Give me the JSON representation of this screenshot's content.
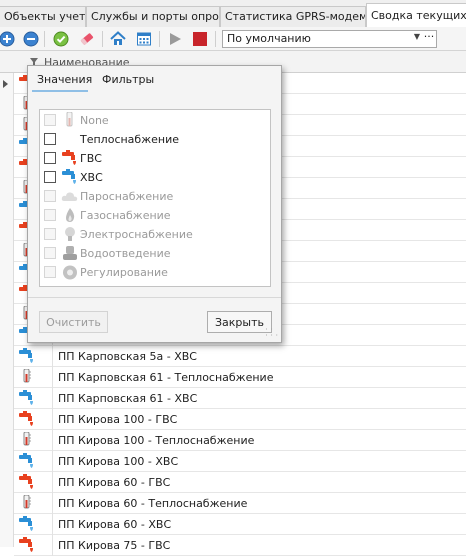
{
  "tabs": [
    {
      "label": "Объекты учета",
      "active": false
    },
    {
      "label": "Службы и порты опроса",
      "active": false
    },
    {
      "label": "Статистика GPRS-модемов",
      "active": false
    },
    {
      "label": "Сводка текущих",
      "active": true
    }
  ],
  "toolbar": {
    "icons": [
      "add-icon",
      "remove-icon",
      "apply-icon",
      "eraser-icon",
      "home-icon",
      "calendar-icon",
      "play-icon",
      "stop-icon"
    ],
    "combo_value": "По умолчанию",
    "combo_dots": "···"
  },
  "grid": {
    "column_header": "Наименование",
    "rows": [
      {
        "icon": "hot-tap-icon",
        "text": ""
      },
      {
        "icon": "thermometer-icon",
        "text": ""
      },
      {
        "icon": "thermometer-icon",
        "text": ""
      },
      {
        "icon": "cold-tap-icon",
        "text": ""
      },
      {
        "icon": "hot-tap-icon",
        "text": ""
      },
      {
        "icon": "thermometer-icon",
        "text": ""
      },
      {
        "icon": "cold-tap-icon",
        "text": ""
      },
      {
        "icon": "hot-tap-icon",
        "text": ""
      },
      {
        "icon": "thermometer-icon",
        "text": ""
      },
      {
        "icon": "cold-tap-icon",
        "text": ""
      },
      {
        "icon": "hot-tap-icon",
        "text": ""
      },
      {
        "icon": "thermometer-icon",
        "text": ""
      },
      {
        "icon": "cold-tap-icon",
        "text": ""
      },
      {
        "icon": "cold-tap-icon",
        "text": "ПП Карповская 5а - ХВС"
      },
      {
        "icon": "thermometer-icon",
        "text": "ПП Карповская 61 - Теплоснабжение"
      },
      {
        "icon": "cold-tap-icon",
        "text": "ПП Карповская 61 - ХВС"
      },
      {
        "icon": "hot-tap-icon",
        "text": "ПП Кирова 100 - ГВС"
      },
      {
        "icon": "thermometer-icon",
        "text": "ПП Кирова 100 - Теплоснабжение"
      },
      {
        "icon": "cold-tap-icon",
        "text": "ПП Кирова 100 - ХВС"
      },
      {
        "icon": "hot-tap-icon",
        "text": "ПП Кирова 60 - ГВС"
      },
      {
        "icon": "thermometer-icon",
        "text": "ПП Кирова 60 - Теплоснабжение"
      },
      {
        "icon": "cold-tap-icon",
        "text": "ПП Кирова 60 - ХВС"
      },
      {
        "icon": "hot-tap-icon",
        "text": "ПП Кирова 75 - ГВС"
      }
    ]
  },
  "filter_popup": {
    "tab_values": "Значения",
    "tab_filters": "Фильтры",
    "items": [
      {
        "label": "None",
        "icon": "thermometer-icon",
        "enabled": false,
        "checked": false
      },
      {
        "label": "Теплоснабжение",
        "icon": "none",
        "enabled": true,
        "checked": false
      },
      {
        "label": "ГВС",
        "icon": "hot-tap-icon",
        "enabled": true,
        "checked": false
      },
      {
        "label": "ХВС",
        "icon": "cold-tap-icon",
        "enabled": true,
        "checked": false
      },
      {
        "label": "Пароснабжение",
        "icon": "cloud-icon",
        "enabled": false,
        "checked": false
      },
      {
        "label": "Газоснабжение",
        "icon": "flame-icon",
        "enabled": false,
        "checked": false
      },
      {
        "label": "Электроснабжение",
        "icon": "lightbulb-icon",
        "enabled": false,
        "checked": false
      },
      {
        "label": "Водоотведение",
        "icon": "drain-icon",
        "enabled": false,
        "checked": false
      },
      {
        "label": "Регулирование",
        "icon": "gear-icon",
        "enabled": false,
        "checked": false
      }
    ],
    "clear_button": "Очистить",
    "close_button": "Закрыть"
  },
  "colors": {
    "hot": "#e8411f",
    "cold": "#2b8fd6",
    "stop": "#c8252b",
    "play": "#9a9a9a",
    "accent": "#8fbfe6"
  }
}
